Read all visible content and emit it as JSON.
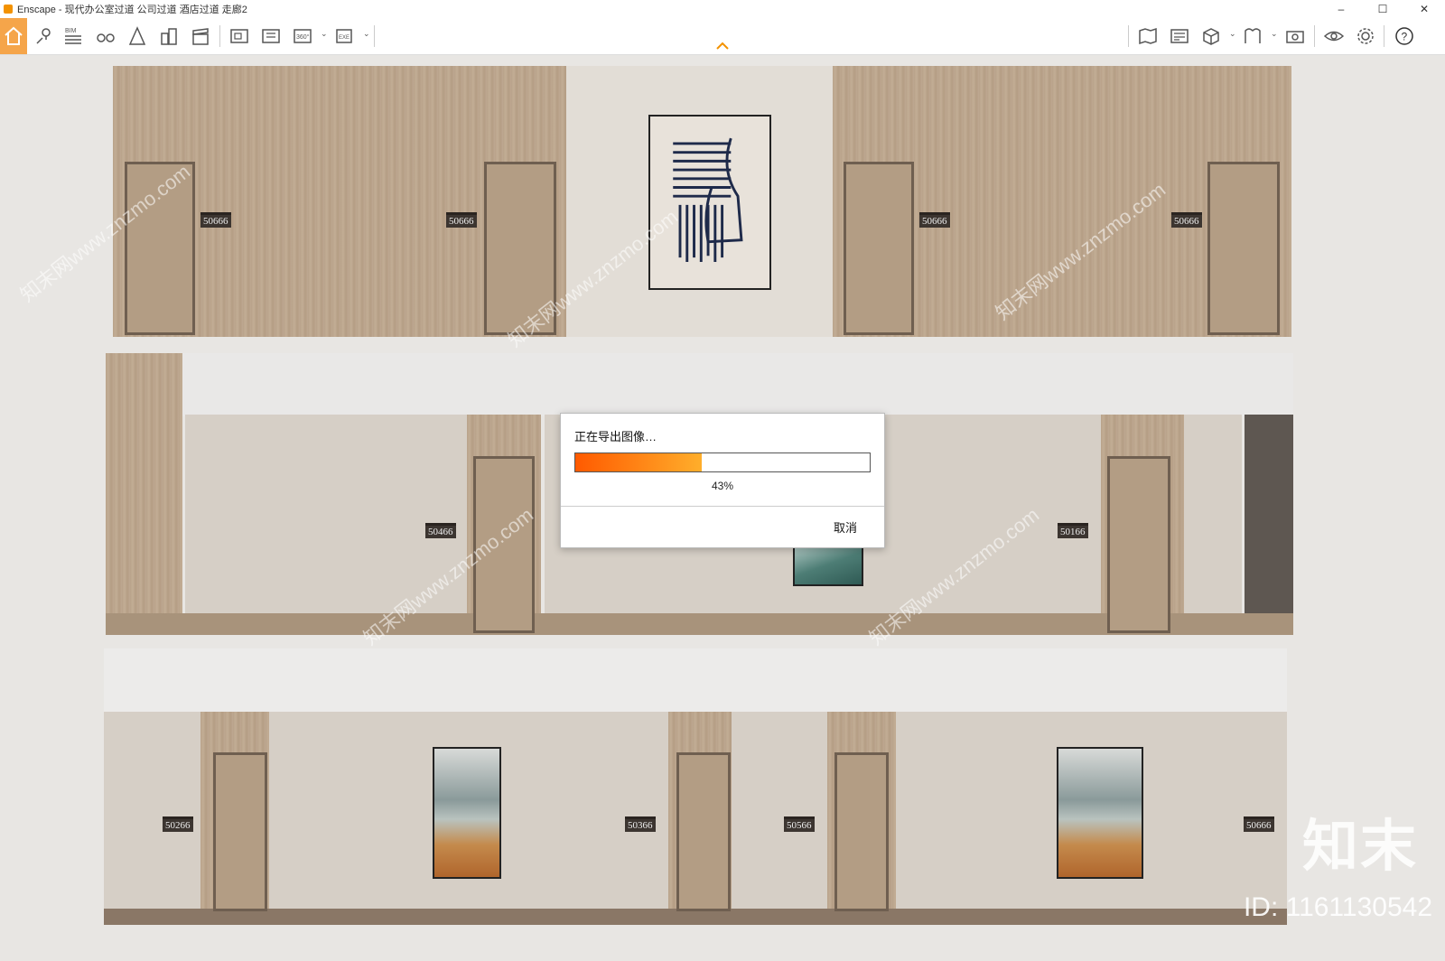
{
  "window": {
    "app_name": "Enscape",
    "title": "Enscape - 现代办公室过道 公司过道 酒店过道 走廊2",
    "minimize": "–",
    "maximize": "☐",
    "close": "✕"
  },
  "toolbar": {
    "left_icons": [
      "home-icon",
      "location-pin-icon",
      "bim-icon",
      "binoculars-icon",
      "asset-icon",
      "buildings-icon",
      "clapper-icon",
      "screenshot-icon",
      "batch-render-icon",
      "panorama-360-icon",
      "export-exe-icon"
    ],
    "bim_label": "BIM",
    "pano_label": "360°",
    "exe_label": "EXE",
    "right_icons": [
      "map-icon",
      "visual-settings-icon",
      "cube-icon",
      "material-icon",
      "camera-icon",
      "eye-icon",
      "gear-icon",
      "help-icon"
    ],
    "accent": "#f39200"
  },
  "scene": {
    "door_numbers_row1": [
      "50666",
      "50666",
      "50666",
      "50666"
    ],
    "door_numbers_row2": [
      "50466",
      "50166"
    ],
    "door_numbers_row3": [
      "50266",
      "50366",
      "50566",
      "50666"
    ],
    "watermark_text": "知末网www.znzmo.com",
    "brand_mark": "知末",
    "id_mark": "ID: 1161130542"
  },
  "export_dialog": {
    "title": "正在导出图像…",
    "progress_percent": 43,
    "percent_label": "43%",
    "cancel_label": "取消",
    "fill_color_start": "#ff5a00",
    "fill_color_end": "#ffae2b"
  }
}
